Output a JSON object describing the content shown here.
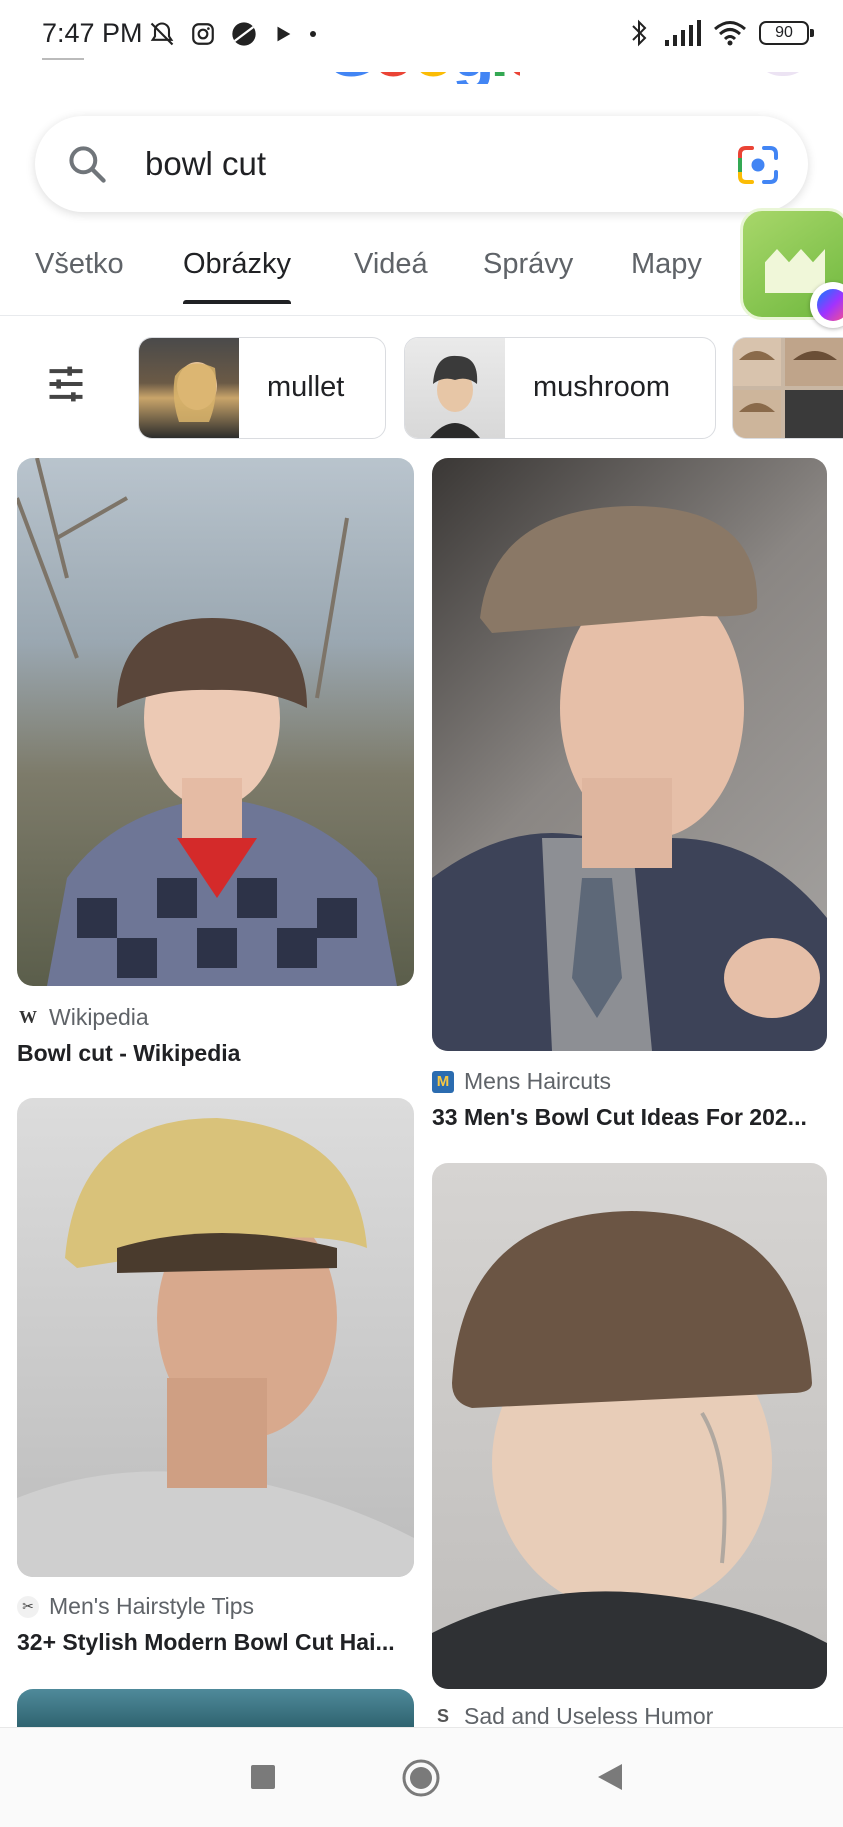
{
  "status_bar": {
    "time": "7:47 PM",
    "battery": "90",
    "left_icons": [
      "mute-bell-icon",
      "instagram-icon",
      "circle-app-icon",
      "play-icon",
      "dot-icon"
    ],
    "right_icons": [
      "bluetooth-icon",
      "signal-icon",
      "wifi-icon",
      "battery-icon"
    ]
  },
  "header": {
    "logo_colors": [
      "#4285f4",
      "#ea4335",
      "#fbbc05",
      "#4285f4",
      "#34a853",
      "#ea4335"
    ]
  },
  "search": {
    "query": "bowl cut",
    "icon": "search-icon",
    "lens_icon": "google-lens-icon"
  },
  "tabs": [
    {
      "label": "Všetko",
      "active": false
    },
    {
      "label": "Obrázky",
      "active": true
    },
    {
      "label": "Videá",
      "active": false
    },
    {
      "label": "Správy",
      "active": false
    },
    {
      "label": "Mapy",
      "active": false
    }
  ],
  "chips": [
    {
      "label": "mullet"
    },
    {
      "label": "mushroom"
    }
  ],
  "results": [
    {
      "source": "Wikipedia",
      "title": "Bowl cut - Wikipedia",
      "source_icon": "wikipedia-icon"
    },
    {
      "source": "Mens Haircuts",
      "title": "33 Men's Bowl Cut Ideas For 202...",
      "source_icon": "mens-haircuts-icon"
    },
    {
      "source": "Men's Hairstyle Tips",
      "title": "32+ Stylish Modern Bowl Cut Hai...",
      "source_icon": "mens-hairstyle-tips-icon"
    },
    {
      "source": "Sad and Useless Humor",
      "title": "",
      "source_icon": "sad-useless-icon"
    }
  ],
  "colors": {
    "accent_blue": "#4285f4",
    "text_primary": "#202124",
    "text_secondary": "#5f6368"
  }
}
